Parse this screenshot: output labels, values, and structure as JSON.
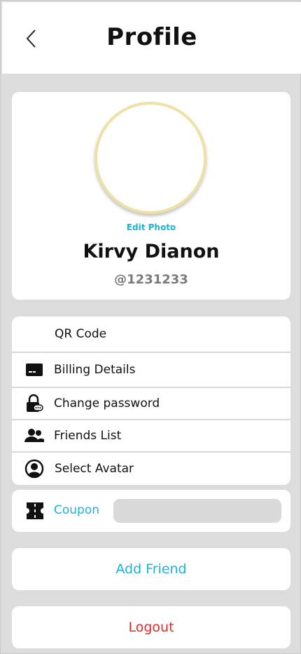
{
  "header": {
    "title": "Profile",
    "back_icon": "chevron-left-icon"
  },
  "profile": {
    "edit_photo_label": "Edit Photo",
    "name": "Kirvy Dianon",
    "handle": "@1231233",
    "avatar_ring_color": "#efe1a6"
  },
  "menu": {
    "items": [
      {
        "label": "QR Code",
        "icon": "none"
      },
      {
        "label": "Billing Details",
        "icon": "credit-card-icon"
      },
      {
        "label": "Change password",
        "icon": "lock-icon"
      },
      {
        "label": "Friends List",
        "icon": "people-icon"
      },
      {
        "label": "Select Avatar",
        "icon": "user-circle-icon"
      }
    ]
  },
  "coupon": {
    "label": "Coupon",
    "icon": "ticket-icon",
    "value": "",
    "placeholder": ""
  },
  "actions": {
    "add_friend_label": "Add Friend",
    "logout_label": "Logout"
  },
  "colors": {
    "accent": "#1ab4d8",
    "danger": "#e02a2a",
    "background": "#dcdcdc"
  }
}
